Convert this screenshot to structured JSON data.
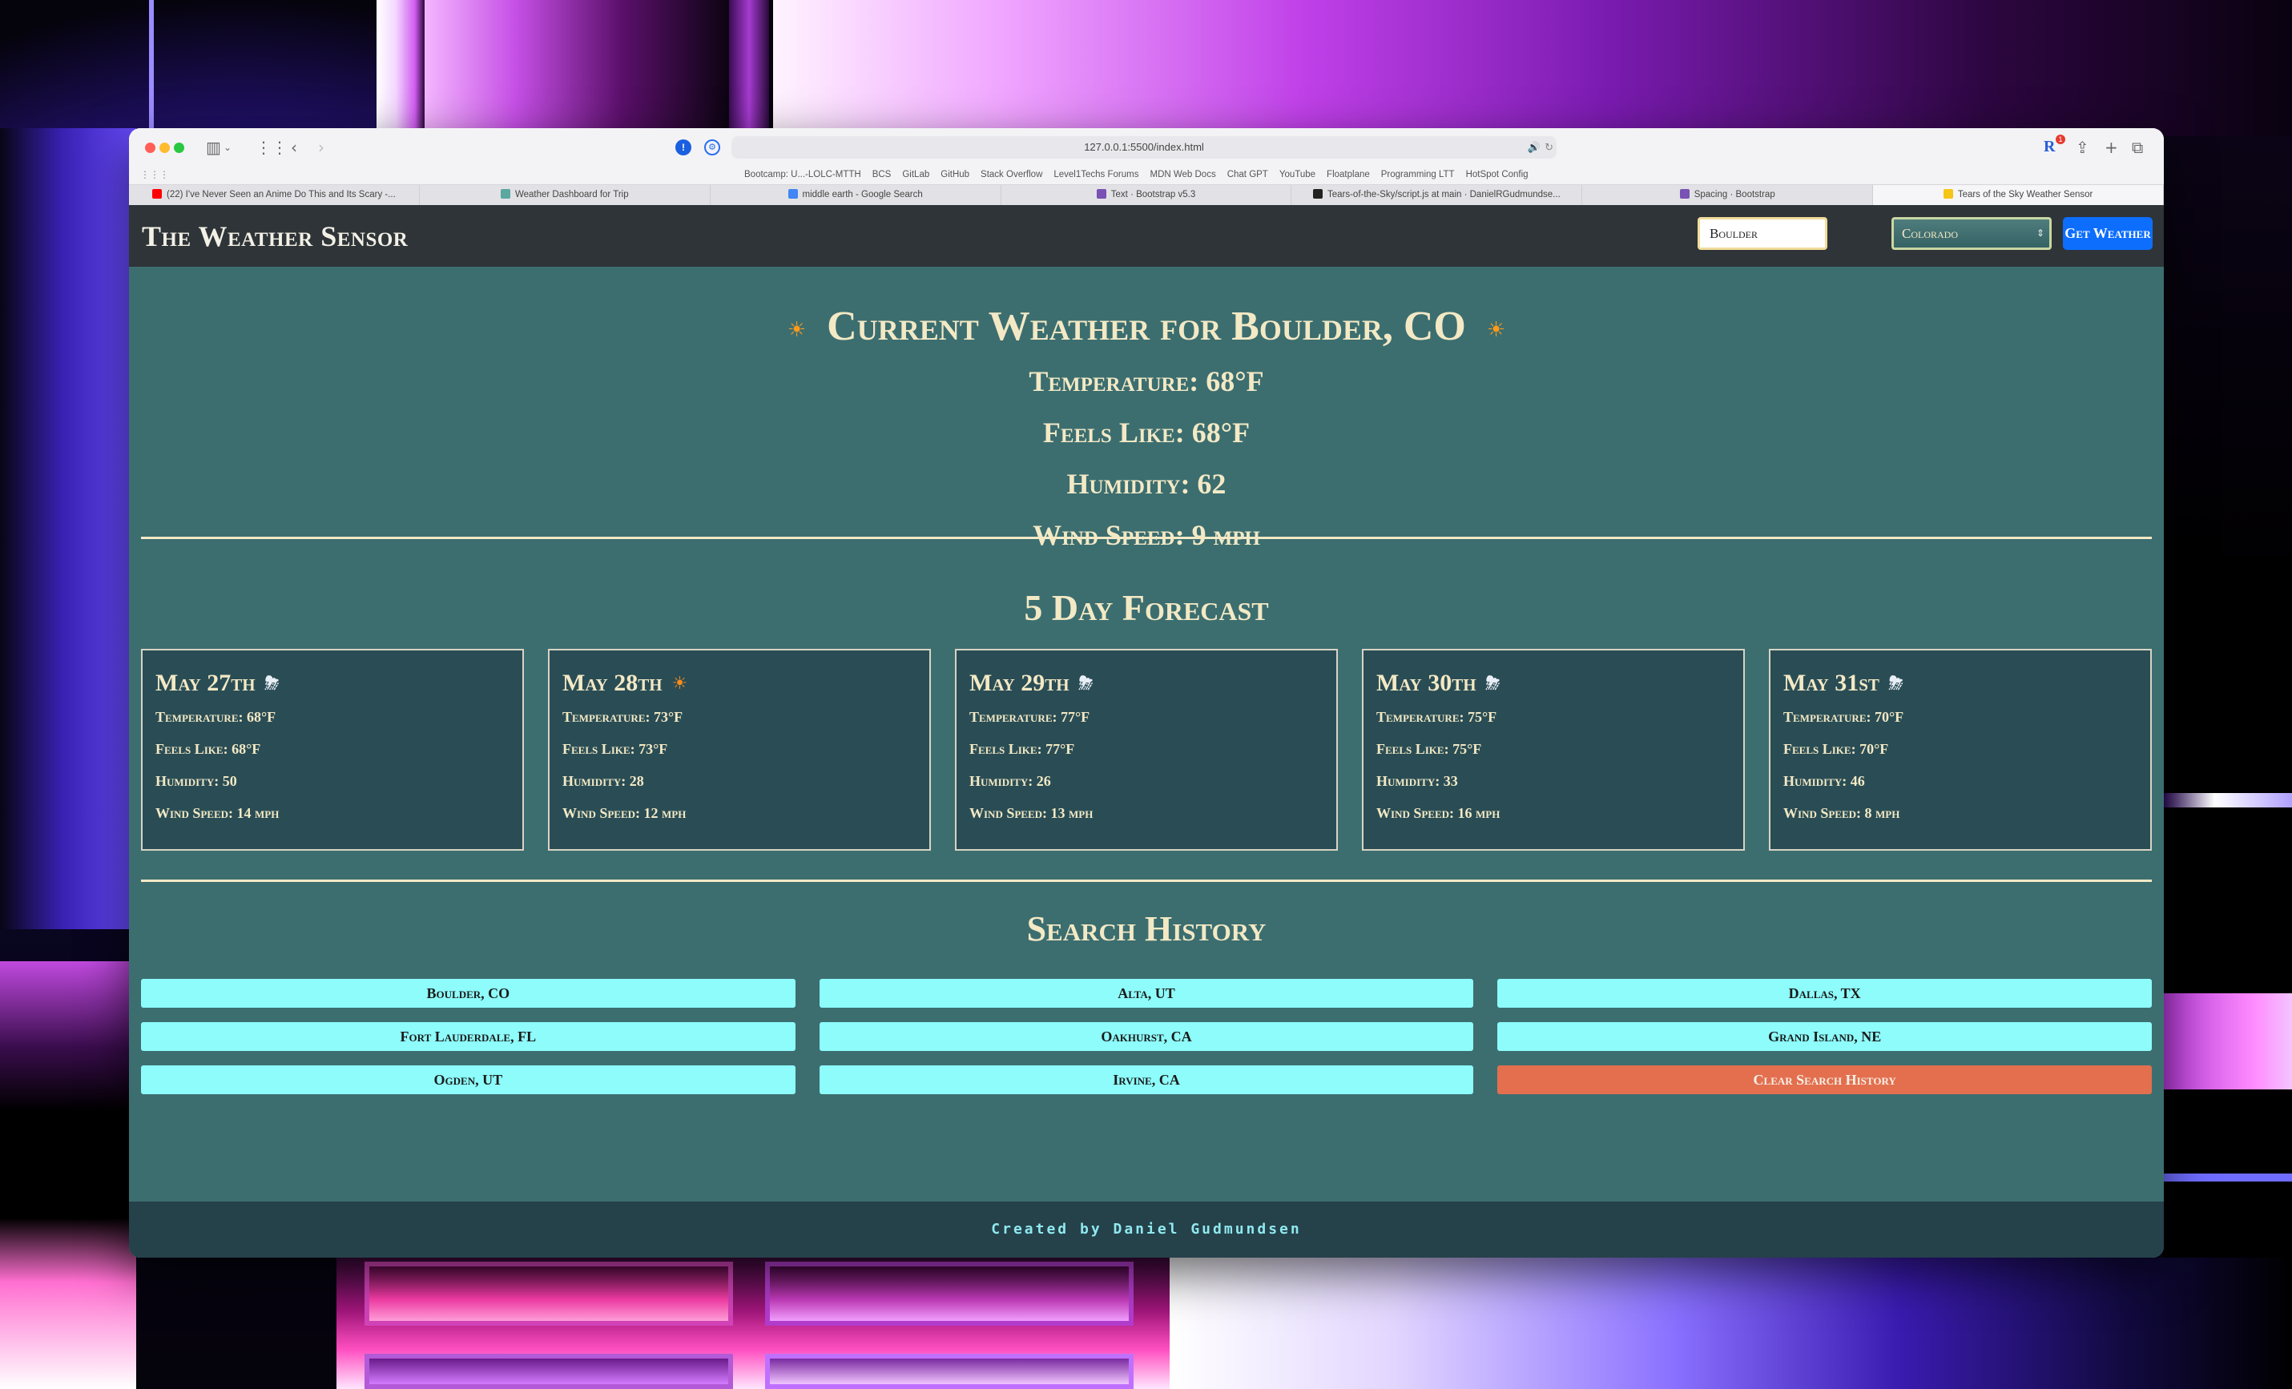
{
  "browser": {
    "url": "127.0.0.1:5500/index.html",
    "extension_badge": "1",
    "bookmarks": [
      "Bootcamp: U...-LOLC-MTTH",
      "BCS",
      "GitLab",
      "GitHub",
      "Stack Overflow",
      "Level1Techs Forums",
      "MDN Web Docs",
      "Chat GPT",
      "YouTube",
      "Floatplane",
      "Programming LTT",
      "HotSpot Config"
    ],
    "tabs": [
      {
        "label": "(22) I've Never Seen an Anime Do This and Its Scary -...",
        "fav_color": "#ff0000"
      },
      {
        "label": "Weather Dashboard for Trip",
        "fav_color": "#5aa8a0"
      },
      {
        "label": "middle earth - Google Search",
        "fav_color": "#4285f4"
      },
      {
        "label": "Text · Bootstrap v5.3",
        "fav_color": "#7952b3"
      },
      {
        "label": "Tears-of-the-Sky/script.js at main · DanielRGudmundse...",
        "fav_color": "#222222"
      },
      {
        "label": "Spacing · Bootstrap",
        "fav_color": "#7952b3"
      },
      {
        "label": "Tears of the Sky Weather Sensor",
        "fav_color": "#f5c518"
      }
    ]
  },
  "navbar": {
    "brand": "The Weather Sensor",
    "city_value": "Boulder",
    "state_value": "Colorado",
    "get_button": "Get Weather"
  },
  "current": {
    "title": "Current Weather for Boulder, CO",
    "temperature": "Temperature: 68°F",
    "feels_like": "Feels Like: 68°F",
    "humidity": "Humidity: 62",
    "wind": "Wind Speed: 9 mph"
  },
  "forecast": {
    "title": "5 Day Forecast",
    "days": [
      {
        "date": "May 27th",
        "icon": "cloud-sun-rain-icon",
        "glyph": "⛈",
        "temp": "Temperature: 68°F",
        "feels": "Feels Like: 68°F",
        "humidity": "Humidity: 50",
        "wind": "Wind Speed: 14 mph"
      },
      {
        "date": "May 28th",
        "icon": "sun-icon",
        "glyph": "☀",
        "temp": "Temperature: 73°F",
        "feels": "Feels Like: 73°F",
        "humidity": "Humidity: 28",
        "wind": "Wind Speed: 12 mph"
      },
      {
        "date": "May 29th",
        "icon": "cloud-sun-rain-icon",
        "glyph": "⛈",
        "temp": "Temperature: 77°F",
        "feels": "Feels Like: 77°F",
        "humidity": "Humidity: 26",
        "wind": "Wind Speed: 13 mph"
      },
      {
        "date": "May 30th",
        "icon": "cloud-sun-rain-icon",
        "glyph": "⛈",
        "temp": "Temperature: 75°F",
        "feels": "Feels Like: 75°F",
        "humidity": "Humidity: 33",
        "wind": "Wind Speed: 16 mph"
      },
      {
        "date": "May 31st",
        "icon": "cloud-sun-rain-icon",
        "glyph": "⛈",
        "temp": "Temperature: 70°F",
        "feels": "Feels Like: 70°F",
        "humidity": "Humidity: 46",
        "wind": "Wind Speed: 8 mph"
      }
    ]
  },
  "history": {
    "title": "Search History",
    "items": [
      "Boulder, CO",
      "Alta, UT",
      "Dallas, TX",
      "Fort Lauderdale, FL",
      "Oakhurst, CA",
      "Grand Island, NE",
      "Ogden, UT",
      "Irvine, CA"
    ],
    "clear_label": "Clear Search History"
  },
  "footer": {
    "text": "Created by Daniel Gudmundsen"
  },
  "colors": {
    "page_bg": "#3c6e70",
    "navbar_bg": "#2e3438",
    "card_bg": "#2a4d55",
    "text_cream": "#f3e9c5",
    "history_button": "#8dfcfb",
    "clear_button": "#e36f4f",
    "primary_button": "#0d6efd"
  }
}
